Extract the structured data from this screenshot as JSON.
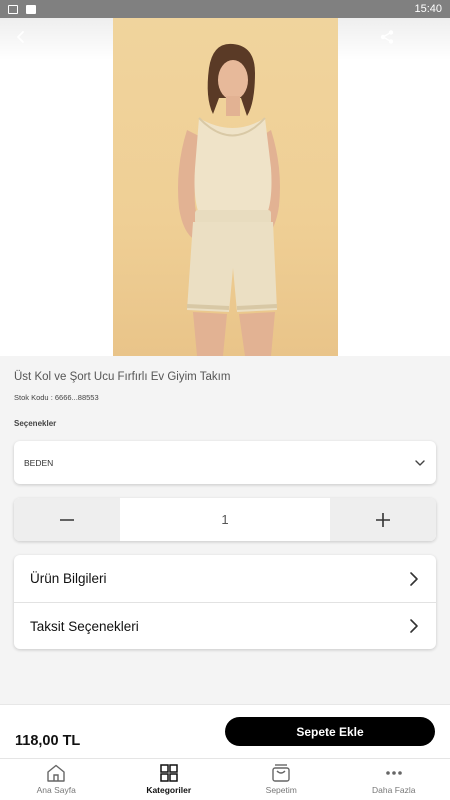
{
  "status_bar": {
    "time": "15:40"
  },
  "product": {
    "title": "Üst Kol ve Şort Ucu Fırfırlı Ev Giyim Takım",
    "sku": "Stok Kodu : 6666...88553"
  },
  "options": {
    "label": "Seçenekler",
    "size_placeholder": "BEDEN"
  },
  "quantity": {
    "value": "1"
  },
  "info_rows": [
    {
      "label": "Ürün Bilgileri"
    },
    {
      "label": "Taksit Seçenekleri"
    }
  ],
  "purchase": {
    "price": "118,00 TL",
    "add_to_cart_label": "Sepete Ekle"
  },
  "tabs": [
    {
      "label": "Ana Sayfa",
      "icon": "home-icon",
      "active": false
    },
    {
      "label": "Kategoriler",
      "icon": "grid-icon",
      "active": true
    },
    {
      "label": "Sepetim",
      "icon": "basket-icon",
      "active": false
    },
    {
      "label": "Daha Fazla",
      "icon": "more-icon",
      "active": false
    }
  ],
  "colors": {
    "accent": "#000000",
    "photo_background": "#efcf95",
    "page_background": "#f4f4f4"
  }
}
